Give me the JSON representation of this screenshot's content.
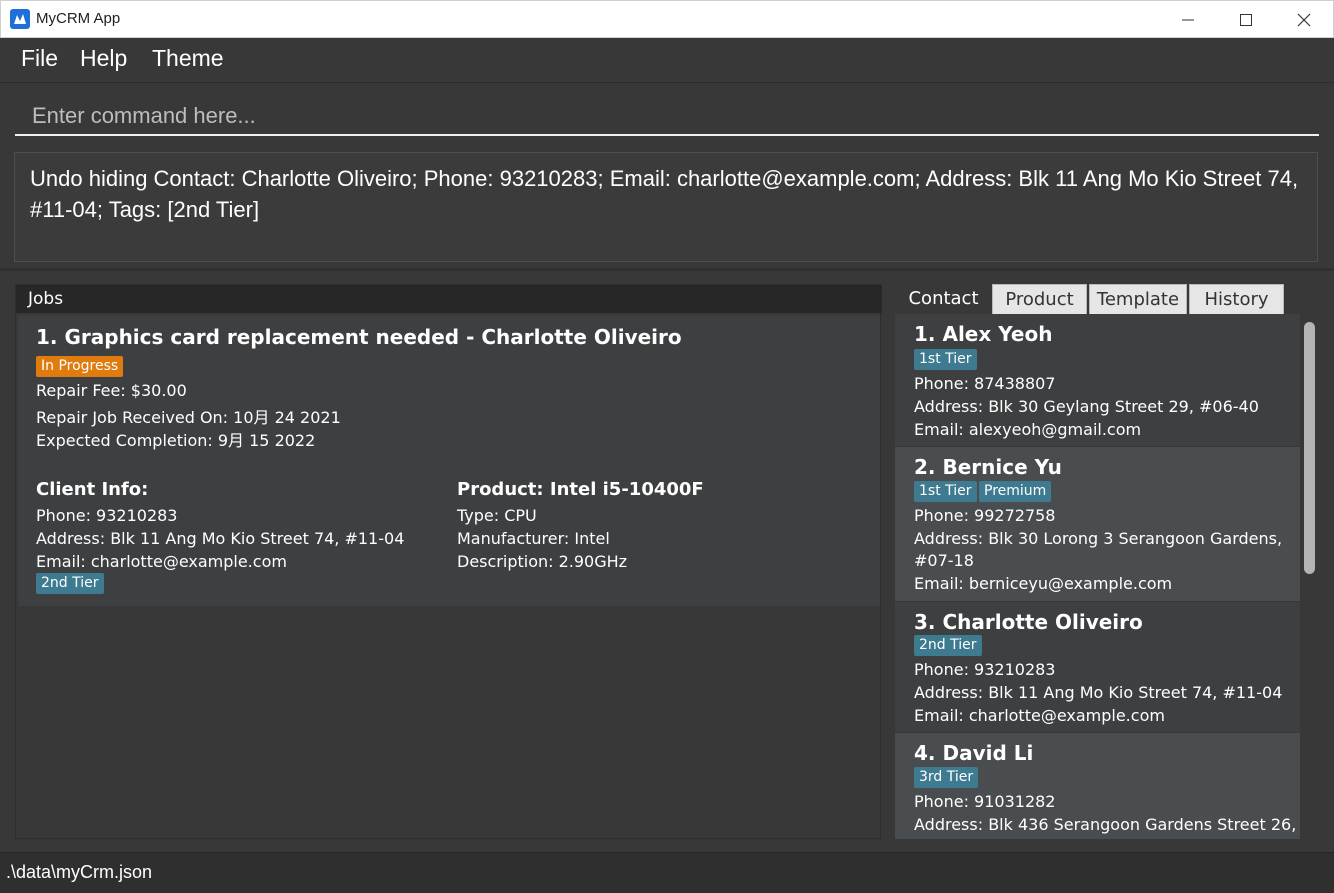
{
  "window": {
    "title": "MyCRM App",
    "controls": [
      "minimize",
      "maximize",
      "close"
    ]
  },
  "menu": {
    "items": [
      "File",
      "Help",
      "Theme"
    ]
  },
  "command": {
    "placeholder": "Enter command here...",
    "value": ""
  },
  "result": {
    "text": "Undo hiding Contact: Charlotte Oliveiro; Phone: 93210283; Email: charlotte@example.com; Address: Blk 11 Ang Mo Kio Street 74, #11-04; Tags: [2nd Tier]"
  },
  "jobs": {
    "header": "Jobs",
    "items": [
      {
        "title": "1. Graphics card replacement needed - Charlotte Oliveiro",
        "status": "In Progress",
        "fee": "Repair Fee: $30.00",
        "received": "Repair Job Received On: 10月 24 2021",
        "expected": "Expected Completion: 9月 15 2022",
        "client": {
          "heading": "Client Info:",
          "phone": "Phone: 93210283",
          "address": "Address: Blk 11 Ang Mo Kio Street 74, #11-04",
          "email": "Email: charlotte@example.com",
          "tag": "2nd Tier"
        },
        "product": {
          "heading": "Product: Intel i5-10400F",
          "type": "Type: CPU",
          "manufacturer": "Manufacturer: Intel",
          "description": "Description: 2.90GHz"
        }
      }
    ]
  },
  "tabs": [
    "Contact",
    "Product",
    "Template",
    "History"
  ],
  "active_tab": "Contact",
  "contacts": [
    {
      "name": "1.  Alex Yeoh",
      "tags": [
        "1st Tier"
      ],
      "phone": "Phone: 87438807",
      "address": [
        "Address: Blk 30 Geylang Street 29, #06-40"
      ],
      "email": "Email: alexyeoh@gmail.com"
    },
    {
      "name": "2.  Bernice Yu",
      "tags": [
        "1st Tier",
        "Premium"
      ],
      "phone": "Phone: 99272758",
      "address": [
        "Address: Blk 30 Lorong 3 Serangoon Gardens,",
        "#07-18"
      ],
      "email": "Email: berniceyu@example.com"
    },
    {
      "name": "3.  Charlotte Oliveiro",
      "tags": [
        "2nd Tier"
      ],
      "phone": "Phone: 93210283",
      "address": [
        "Address: Blk 11 Ang Mo Kio Street 74, #11-04"
      ],
      "email": "Email: charlotte@example.com"
    },
    {
      "name": "4.  David Li",
      "tags": [
        "3rd Tier"
      ],
      "phone": "Phone: 91031282",
      "address": [
        "Address: Blk 436 Serangoon Gardens Street 26,"
      ],
      "email": ""
    }
  ],
  "status_bar": {
    "path": ".\\data\\myCrm.json"
  },
  "colors": {
    "background": "#383838",
    "tag_teal": "#3e7b91",
    "tag_orange": "#e07b0e",
    "accent_blue": "#1e6fd9"
  }
}
